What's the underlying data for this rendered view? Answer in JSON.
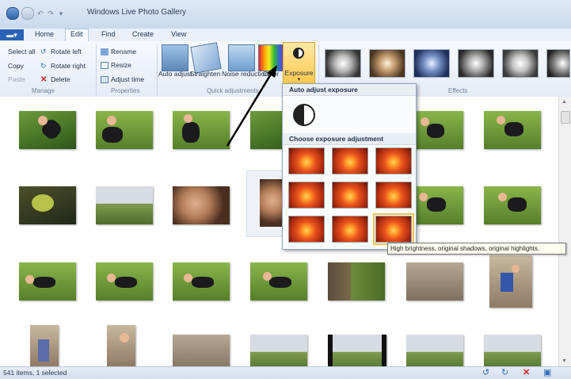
{
  "window": {
    "title": "Windows Live Photo Gallery"
  },
  "tabs": {
    "file": "",
    "items": [
      "Home",
      "Edit",
      "Find",
      "Create",
      "View"
    ],
    "active": "Edit"
  },
  "manage": {
    "label": "Manage",
    "select_all": "Select all",
    "copy": "Copy",
    "paste": "Paste",
    "rotate_left": "Rotate left",
    "rotate_right": "Rotate right",
    "delete": "Delete"
  },
  "properties": {
    "label": "Properties",
    "rename": "Rename",
    "resize": "Resize",
    "adjust_time": "Adjust time"
  },
  "quick_adjustments": {
    "label": "Quick adjustments",
    "auto_adjust": "Auto adjust",
    "straighten": "Straighten",
    "noise_reduction": "Noise reduction",
    "color": "Color",
    "exposure": "Exposure"
  },
  "effects": {
    "label": "Effects"
  },
  "exposure_menu": {
    "auto_header": "Auto adjust exposure",
    "choose_header": "Choose exposure adjustment"
  },
  "tooltip": "High brightness, original shadows, original highlights.",
  "status": {
    "text": "541 items, 1 selected"
  },
  "icons": {
    "rotate_left": "rotate-left-icon",
    "rotate_right": "rotate-right-icon",
    "delete": "delete-icon",
    "slideshow": "slideshow-icon"
  },
  "colors": {
    "accent": "#2a63b5",
    "selection": "#ffc94d",
    "ribbon": "#e4ecf6"
  }
}
